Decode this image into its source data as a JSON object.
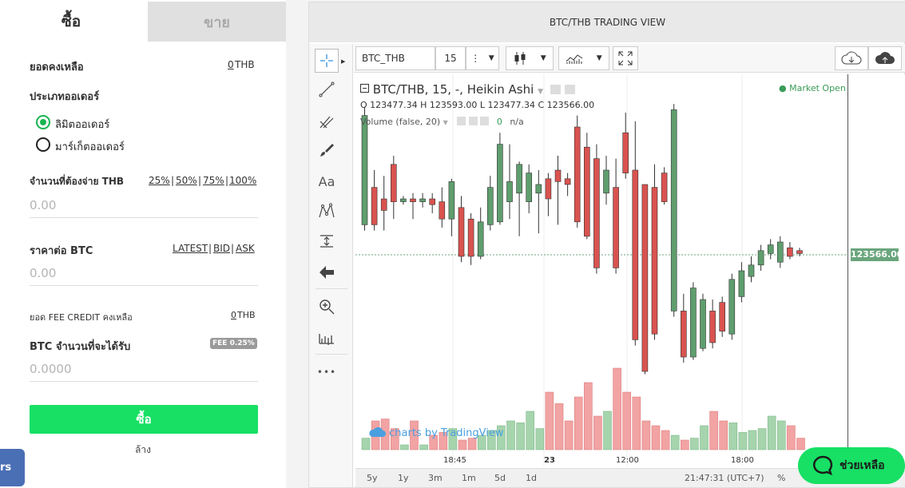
{
  "order": {
    "tab_buy": "ซื้อ",
    "tab_sell": "ขาย",
    "balance_label": "ยอดคงเหลือ",
    "balance_value": "0",
    "balance_unit": "THB",
    "order_type_label": "ประเภทออเดอร์",
    "limit_order": "ลิมิตออเดอร์",
    "market_order": "มาร์เก็ตออเดอร์",
    "pay_label": "จำนวนที่ต้องจ่าย THB",
    "pct_25": "25%",
    "pct_50": "50%",
    "pct_75": "75%",
    "pct_100": "100%",
    "pay_placeholder": "0.00",
    "price_label": "ราคาต่อ BTC",
    "latest": "LATEST",
    "bid": "BID",
    "ask": "ASK",
    "price_placeholder": "0.00",
    "fee_credit_label": "ยอด FEE CREDIT คงเหลือ",
    "fee_credit_value": "0",
    "fee_credit_unit": "THB",
    "receive_label": "BTC จำนวนที่จะได้รับ",
    "fee_badge": "FEE 0.25%",
    "receive_placeholder": "0.0000",
    "buy_button": "ซื้อ",
    "clear": "ล้าง",
    "side_tab": "rs"
  },
  "tv": {
    "header": "BTC/THB TRADING VIEW",
    "symbol": "BTC_THB",
    "interval": "15",
    "legend_title": "BTC/THB, 15, -, Heikin Ashi",
    "ohlc": "O 123477.34  H 123593.00  L 123477.34  C 123566.00",
    "volume_legend": "Volume (false, 20)",
    "volume_value": "0",
    "volume_na": "n/a",
    "market_status": "Market Open",
    "watermark": "charts by TradingView",
    "last_price": "123566.00",
    "time_labels": [
      "18:45",
      "23",
      "12:00",
      "18:00"
    ],
    "ranges": [
      "5y",
      "1y",
      "3m",
      "1m",
      "5d",
      "1d"
    ],
    "clock": "21:47:31 (UTC+7)",
    "pct_btn": "%",
    "text_tool": "Aa",
    "more": "•••"
  },
  "help_button": "ช่วยเหลือ",
  "colors": {
    "up": "#5f9e6e",
    "down": "#d9534f",
    "accent": "#17e065",
    "link": "#2f7fd1"
  },
  "chart_data": {
    "type": "candlestick",
    "title": "BTC/THB, 15, -, Heikin Ashi",
    "last": 123566.0,
    "candles": [
      {
        "o": 0.44,
        "c": 0.06,
        "h": 0.03,
        "l": 0.46
      },
      {
        "o": 0.31,
        "c": 0.44,
        "h": 0.25,
        "l": 0.46
      },
      {
        "o": 0.35,
        "c": 0.39,
        "h": 0.27,
        "l": 0.46
      },
      {
        "o": 0.23,
        "c": 0.36,
        "h": 0.2,
        "l": 0.42
      },
      {
        "o": 0.36,
        "c": 0.35,
        "h": 0.34,
        "l": 0.37
      },
      {
        "o": 0.35,
        "c": 0.36,
        "h": 0.33,
        "l": 0.42
      },
      {
        "o": 0.36,
        "c": 0.35,
        "h": 0.33,
        "l": 0.38
      },
      {
        "o": 0.35,
        "c": 0.37,
        "h": 0.33,
        "l": 0.4
      },
      {
        "o": 0.36,
        "c": 0.42,
        "h": 0.31,
        "l": 0.45
      },
      {
        "o": 0.42,
        "c": 0.29,
        "h": 0.28,
        "l": 0.48
      },
      {
        "o": 0.38,
        "c": 0.55,
        "h": 0.34,
        "l": 0.57
      },
      {
        "o": 0.42,
        "c": 0.55,
        "h": 0.4,
        "l": 0.58
      },
      {
        "o": 0.55,
        "c": 0.43,
        "h": 0.38,
        "l": 0.56
      },
      {
        "o": 0.44,
        "c": 0.31,
        "h": 0.27,
        "l": 0.46
      },
      {
        "o": 0.43,
        "c": 0.16,
        "h": 0.12,
        "l": 0.44
      },
      {
        "o": 0.36,
        "c": 0.29,
        "h": 0.16,
        "l": 0.42
      },
      {
        "o": 0.33,
        "c": 0.23,
        "h": 0.22,
        "l": 0.48
      },
      {
        "o": 0.36,
        "c": 0.26,
        "h": 0.23,
        "l": 0.4
      },
      {
        "o": 0.33,
        "c": 0.3,
        "h": 0.25,
        "l": 0.47
      },
      {
        "o": 0.28,
        "c": 0.35,
        "h": 0.26,
        "l": 0.41
      },
      {
        "o": 0.25,
        "c": 0.29,
        "h": 0.2,
        "l": 0.44
      },
      {
        "o": 0.28,
        "c": 0.3,
        "h": 0.26,
        "l": 0.34
      },
      {
        "o": 0.1,
        "c": 0.43,
        "h": 0.06,
        "l": 0.45
      },
      {
        "o": 0.17,
        "c": 0.48,
        "h": 0.12,
        "l": 0.49
      },
      {
        "o": 0.21,
        "c": 0.59,
        "h": 0.16,
        "l": 0.61
      },
      {
        "o": 0.33,
        "c": 0.25,
        "h": 0.2,
        "l": 0.37
      },
      {
        "o": 0.31,
        "c": 0.59,
        "h": 0.21,
        "l": 0.61
      },
      {
        "o": 0.12,
        "c": 0.26,
        "h": 0.05,
        "l": 0.28
      },
      {
        "o": 0.25,
        "c": 0.84,
        "h": 0.08,
        "l": 0.86
      },
      {
        "o": 0.3,
        "c": 0.95,
        "h": 0.69,
        "l": 0.96
      },
      {
        "o": 0.31,
        "c": 0.82,
        "h": 0.23,
        "l": 0.84
      },
      {
        "o": 0.26,
        "c": 0.36,
        "h": 0.24,
        "l": 0.37
      },
      {
        "o": 0.74,
        "c": 0.04,
        "h": 0.02,
        "l": 0.76
      },
      {
        "o": 0.74,
        "c": 0.9,
        "h": 0.68,
        "l": 0.92
      },
      {
        "o": 0.9,
        "c": 0.66,
        "h": 0.64,
        "l": 0.91
      },
      {
        "o": 0.87,
        "c": 0.7,
        "h": 0.68,
        "l": 0.88
      },
      {
        "o": 0.74,
        "c": 0.85,
        "h": 0.7,
        "l": 0.87
      },
      {
        "o": 0.71,
        "c": 0.81,
        "h": 0.69,
        "l": 0.83
      },
      {
        "o": 0.82,
        "c": 0.63,
        "h": 0.61,
        "l": 0.84
      },
      {
        "o": 0.69,
        "c": 0.6,
        "h": 0.57,
        "l": 0.71
      },
      {
        "o": 0.62,
        "c": 0.58,
        "h": 0.55,
        "l": 0.64
      },
      {
        "o": 0.58,
        "c": 0.53,
        "h": 0.51,
        "l": 0.6
      },
      {
        "o": 0.54,
        "c": 0.51,
        "h": 0.49,
        "l": 0.56
      },
      {
        "o": 0.57,
        "c": 0.5,
        "h": 0.48,
        "l": 0.59
      },
      {
        "o": 0.52,
        "c": 0.55,
        "h": 0.5,
        "l": 0.56
      },
      {
        "o": 0.53,
        "c": 0.54,
        "h": 0.52,
        "l": 0.55
      }
    ],
    "volume": [
      0.12,
      0.3,
      0.32,
      0.22,
      0.05,
      0.3,
      0.05,
      0.15,
      0.18,
      0.22,
      0.1,
      0.12,
      0.15,
      0.2,
      0.25,
      0.3,
      0.28,
      0.4,
      0.22,
      0.6,
      0.48,
      0.3,
      0.55,
      0.7,
      0.35,
      0.4,
      0.85,
      0.6,
      0.55,
      0.3,
      0.25,
      0.2,
      0.15,
      0.1,
      0.12,
      0.25,
      0.4,
      0.3,
      0.28,
      0.18,
      0.2,
      0.22,
      0.35,
      0.3,
      0.25,
      0.12
    ]
  }
}
